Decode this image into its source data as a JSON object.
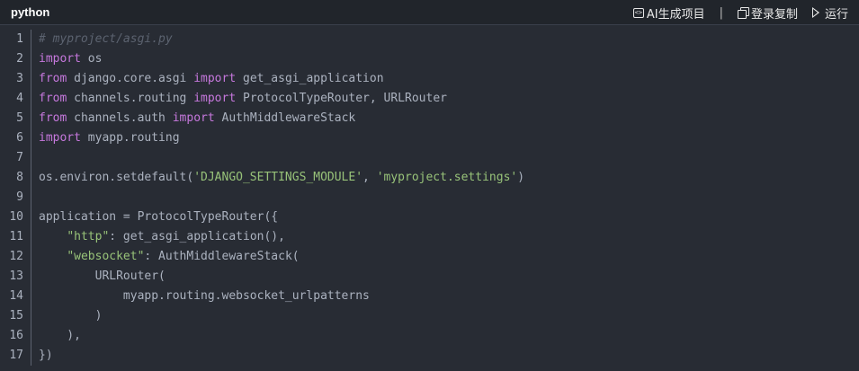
{
  "header": {
    "language": "python",
    "ai_label": "AI生成项目",
    "separator": "|",
    "copy_label": "登录复制",
    "run_label": "运行"
  },
  "code": {
    "lines": [
      [
        {
          "t": "com",
          "s": "# myproject/asgi.py"
        }
      ],
      [
        {
          "t": "kw",
          "s": "import"
        },
        {
          "t": "plain",
          "s": " os"
        }
      ],
      [
        {
          "t": "kw",
          "s": "from"
        },
        {
          "t": "plain",
          "s": " django.core.asgi "
        },
        {
          "t": "kw",
          "s": "import"
        },
        {
          "t": "plain",
          "s": " get_asgi_application"
        }
      ],
      [
        {
          "t": "kw",
          "s": "from"
        },
        {
          "t": "plain",
          "s": " channels.routing "
        },
        {
          "t": "kw",
          "s": "import"
        },
        {
          "t": "plain",
          "s": " ProtocolTypeRouter, URLRouter"
        }
      ],
      [
        {
          "t": "kw",
          "s": "from"
        },
        {
          "t": "plain",
          "s": " channels.auth "
        },
        {
          "t": "kw",
          "s": "import"
        },
        {
          "t": "plain",
          "s": " AuthMiddlewareStack"
        }
      ],
      [
        {
          "t": "kw",
          "s": "import"
        },
        {
          "t": "plain",
          "s": " myapp.routing"
        }
      ],
      [],
      [
        {
          "t": "plain",
          "s": "os.environ.setdefault("
        },
        {
          "t": "str",
          "s": "'DJANGO_SETTINGS_MODULE'"
        },
        {
          "t": "plain",
          "s": ", "
        },
        {
          "t": "str",
          "s": "'myproject.settings'"
        },
        {
          "t": "plain",
          "s": ")"
        }
      ],
      [],
      [
        {
          "t": "plain",
          "s": "application = ProtocolTypeRouter({"
        }
      ],
      [
        {
          "t": "plain",
          "s": "    "
        },
        {
          "t": "str",
          "s": "\"http\""
        },
        {
          "t": "plain",
          "s": ": get_asgi_application(),"
        }
      ],
      [
        {
          "t": "plain",
          "s": "    "
        },
        {
          "t": "str",
          "s": "\"websocket\""
        },
        {
          "t": "plain",
          "s": ": AuthMiddlewareStack("
        }
      ],
      [
        {
          "t": "plain",
          "s": "        URLRouter("
        }
      ],
      [
        {
          "t": "plain",
          "s": "            myapp.routing.websocket_urlpatterns"
        }
      ],
      [
        {
          "t": "plain",
          "s": "        )"
        }
      ],
      [
        {
          "t": "plain",
          "s": "    ),"
        }
      ],
      [
        {
          "t": "plain",
          "s": "})"
        }
      ]
    ]
  }
}
